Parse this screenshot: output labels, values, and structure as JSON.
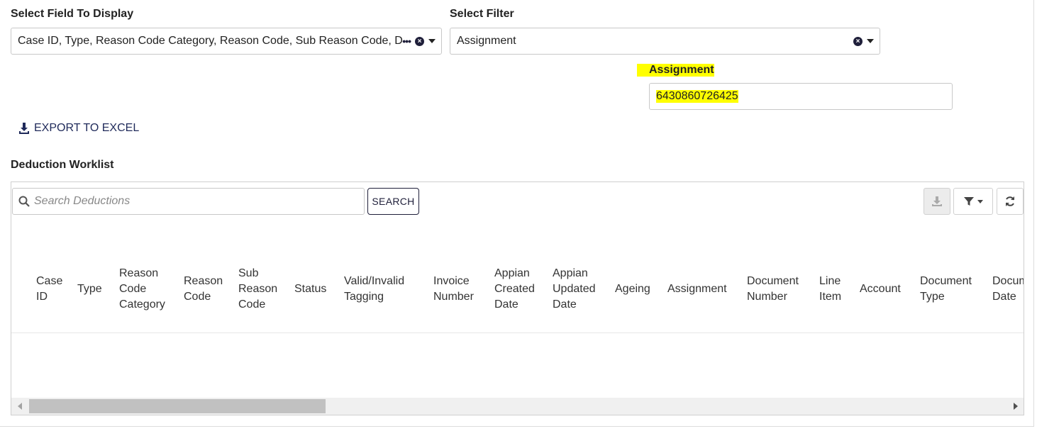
{
  "field_select": {
    "label": "Select Field To Display",
    "value": "Case ID, Type, Reason Code Category, Reason Code, Sub Reason Code, Document Number, Line Item, Account, Document Type, Document Date"
  },
  "filter_select": {
    "label": "Select Filter",
    "value": "Assignment"
  },
  "assignment_filter": {
    "label": "Assignment",
    "value": "6430860726425"
  },
  "export": {
    "label": "EXPORT TO EXCEL"
  },
  "worklist": {
    "title": "Deduction Worklist",
    "search_placeholder": "Search Deductions",
    "search_button": "SEARCH",
    "columns": [
      [
        "Case",
        "ID"
      ],
      [
        "Type"
      ],
      [
        "Reason",
        "Code",
        "Category"
      ],
      [
        "Reason",
        "Code"
      ],
      [
        "Sub",
        "Reason",
        "Code"
      ],
      [
        "Status"
      ],
      [
        "Valid/Invalid",
        "Tagging"
      ],
      [
        "Invoice",
        "Number"
      ],
      [
        "Appian",
        "Created",
        "Date"
      ],
      [
        "Appian",
        "Updated",
        "Date"
      ],
      [
        "Ageing"
      ],
      [
        "Assignment"
      ],
      [
        "Document",
        "Number"
      ],
      [
        "Line",
        "Item"
      ],
      [
        "Account"
      ],
      [
        "Document",
        "Type"
      ],
      [
        "Document",
        "Date"
      ]
    ]
  },
  "icons": {
    "export": "download-icon",
    "search": "search-icon",
    "toolbar": [
      "download-icon",
      "filter-icon",
      "refresh-icon"
    ]
  },
  "colors": {
    "highlight": "#ffff00",
    "accent": "#1f2a5a"
  }
}
